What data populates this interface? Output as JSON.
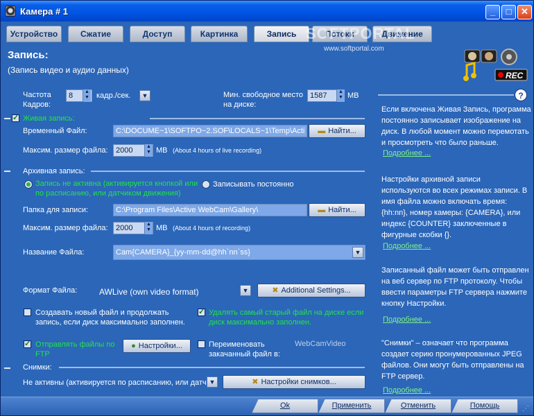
{
  "window": {
    "title": "Камера # 1"
  },
  "tabs": [
    {
      "label": "Устройство",
      "active": false
    },
    {
      "label": "Сжатие",
      "active": false
    },
    {
      "label": "Доступ",
      "active": false
    },
    {
      "label": "Картинка",
      "active": false
    },
    {
      "label": "Запись",
      "active": true
    },
    {
      "label": "Потоки",
      "active": false
    },
    {
      "label": "Движение",
      "active": false
    }
  ],
  "watermark": {
    "brand": "SOFTPORTAL",
    "url": "www.softportal.com"
  },
  "header": {
    "title": "Запись:",
    "subtitle": "(Запись видео и аудио данных)",
    "logo_text": "REC"
  },
  "framerate": {
    "label": "Частота Кадров:",
    "value": "8",
    "unit": "кадр./сек."
  },
  "free_space": {
    "label": "Мин. свободное место на диске:",
    "value": "1587",
    "unit": "MB"
  },
  "live": {
    "checkbox_label": "Живая запись:",
    "temp_file_label": "Временный Файл:",
    "temp_file_value": "C:\\DOCUME~1\\SOFTPO~2.SOF\\LOCALS~1\\Temp\\Acti",
    "find_button": "Найти...",
    "max_size_label": "Максим. размер файла:",
    "max_size_value": "2000",
    "max_size_unit": "MB",
    "max_size_note": "(About 4 hours of live recording)"
  },
  "archive": {
    "section_label": "Архивная запись:",
    "radio_inactive": "Запись не активна (активируется кнопкой или по расписанию, или датчиком движения)",
    "radio_always": "Записывать постоянно",
    "folder_label": "Папка для записи:",
    "folder_value": "C:\\Program Files\\Active WebCam\\Gallery\\",
    "find_button": "Найти...",
    "max_size_label": "Максим. размер файла:",
    "max_size_value": "2000",
    "max_size_unit": "MB",
    "max_size_note": "(About 4 hours of recording)",
    "filename_label": "Название Файла:",
    "filename_value": "Cam{CAMERA}_{yy-mm-dd@hh`nn`ss}",
    "format_label": "Формат Файла:",
    "format_value": "AWLive (own video format)",
    "additional_button": "Additional Settings...",
    "new_file_label": "Создавать новый файл и продолжать запись, если диск максимально заполнен.",
    "delete_old_label": "Удалять самый старый файл на диске если диск максимально заполнен.",
    "send_files_label": "Отправлять файлы по FTP",
    "settings_button": "Настройки...",
    "rename_label": "Переименовать закачанный файл в:",
    "rename_value": "WebCamVideo"
  },
  "snapshots": {
    "section_label": "Снимки:",
    "mode_value": "Не активны (активируется по расписанию, или датч",
    "settings_button": "Настройки снимков..."
  },
  "help": {
    "live": "Если включена Живая Запись, программа постоянно записывает изображение на диск. В любой момент можно перемотать и просмотреть что было раньше.",
    "archive": "Настройки архивной записи используются во всех режимах записи. В имя файла можно включать время: {hh:nn}, номер камеры: {CAMERA}, или индекс {COUNTER} заключенные в фигурные скобки {}.",
    "ftp": "Записанный файл может быть отправлен на веб сервер по FTP протоколу. Чтобы ввести параметры FTP сервера нажмите кнопку Настройки.",
    "snapshots": "\"Снимки\" – означает что программа создает серию пронумерованных JPEG файлов. Они могут быть отправлены на FTP сервер.",
    "more": "Подробнее ..."
  },
  "buttons": {
    "ok": "Ok",
    "apply": "Применить",
    "cancel": "Отменить",
    "help": "Помощь"
  }
}
